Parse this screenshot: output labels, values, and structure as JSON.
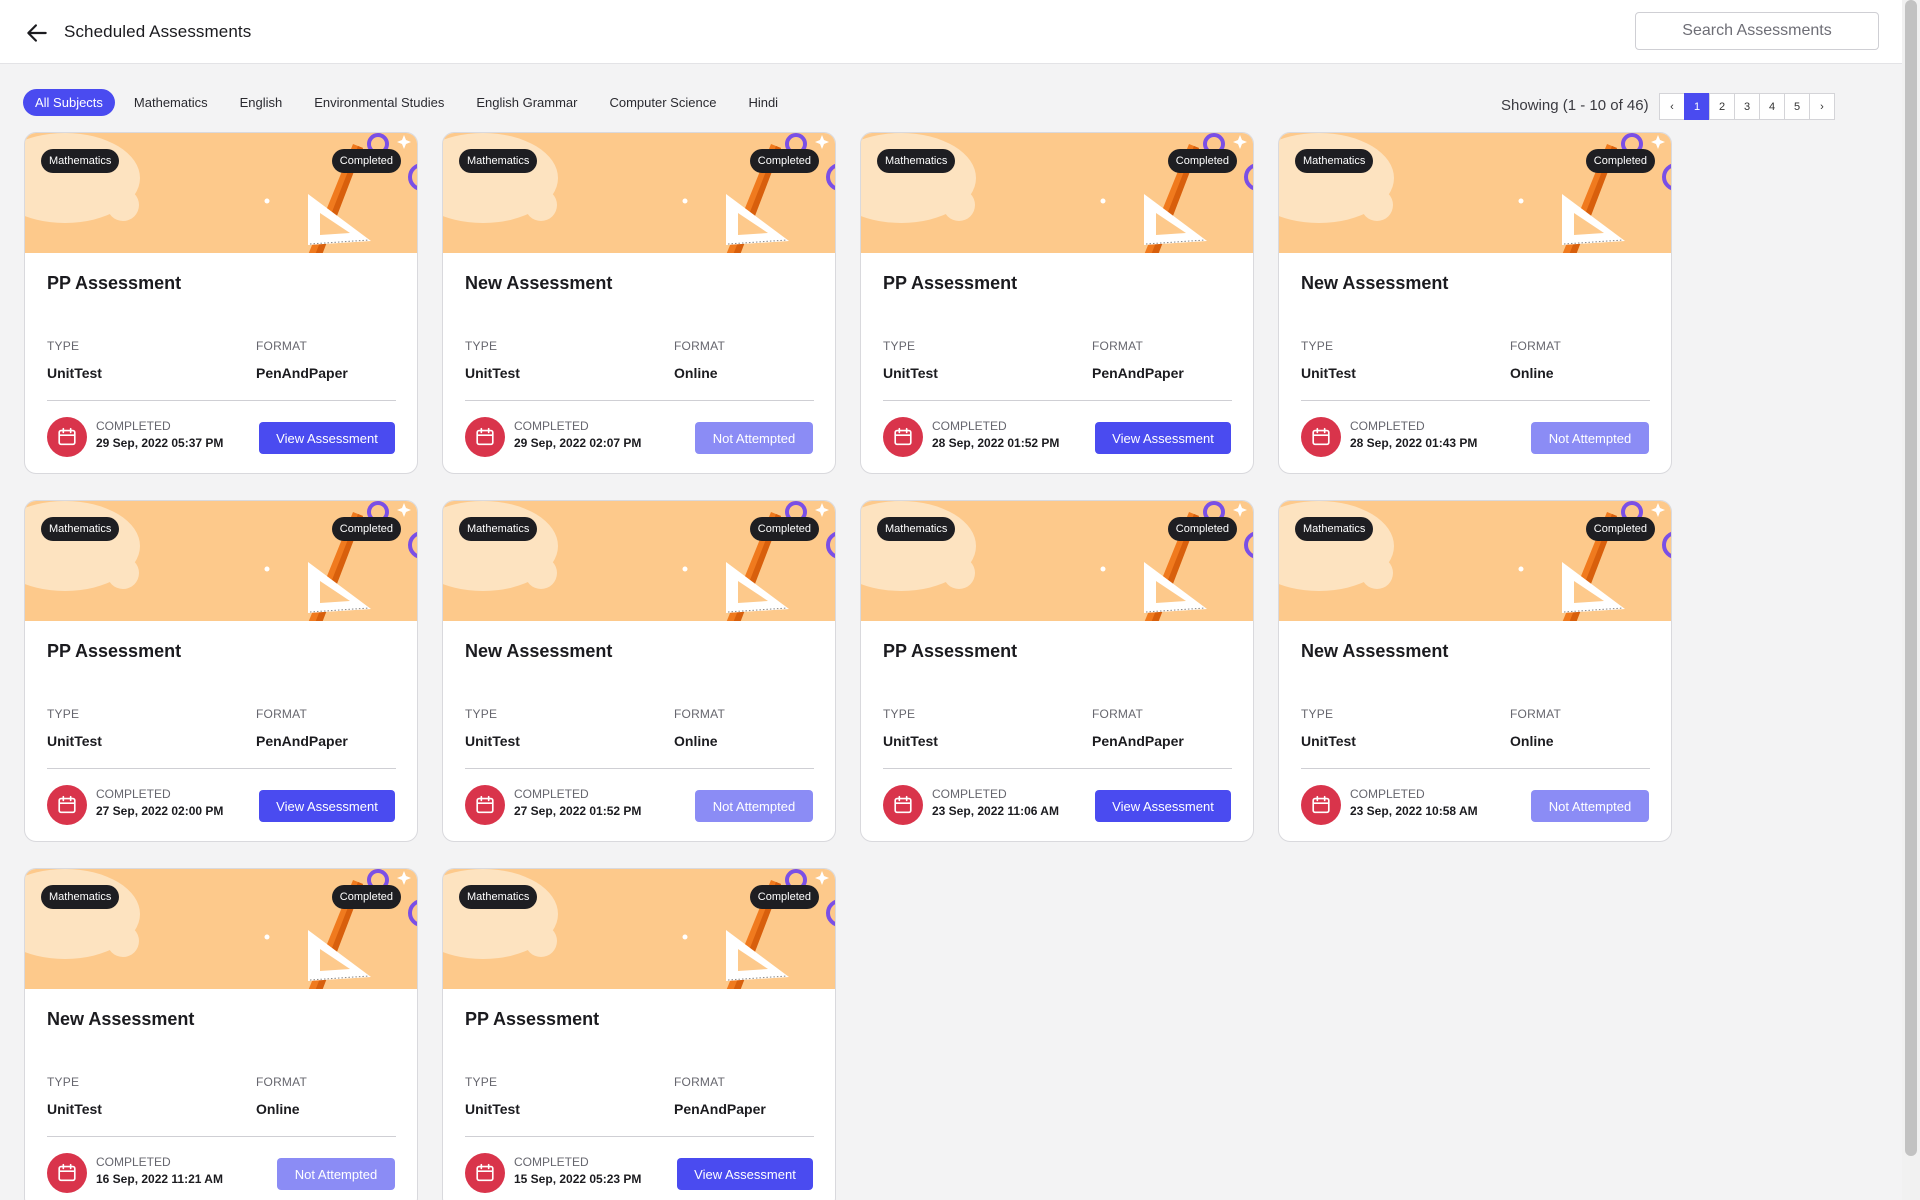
{
  "header": {
    "title": "Scheduled Assessments",
    "search_placeholder": "Search Assessments"
  },
  "filters": [
    "All Subjects",
    "Mathematics",
    "English",
    "Environmental Studies",
    "English Grammar",
    "Computer Science",
    "Hindi"
  ],
  "active_filter": "All Subjects",
  "pagination": {
    "showing": "Showing (1 - 10 of 46)",
    "prev": "‹",
    "next": "›",
    "pages": [
      "1",
      "2",
      "3",
      "4",
      "5"
    ],
    "current": "1"
  },
  "labels": {
    "type": "TYPE",
    "format": "FORMAT",
    "completed": "COMPLETED"
  },
  "colors": {
    "accent": "#4a4bf0",
    "accent_disabled": "#8b8cf5",
    "banner": "#fdc98b",
    "calendar": "#d9344b"
  },
  "cards": [
    {
      "subject": "Mathematics",
      "status": "Completed",
      "title": "PP Assessment",
      "type": "UnitTest",
      "format": "PenAndPaper",
      "date": "29 Sep, 2022 05:37 PM",
      "action": "View Assessment",
      "action_kind": "view"
    },
    {
      "subject": "Mathematics",
      "status": "Completed",
      "title": "New Assessment",
      "type": "UnitTest",
      "format": "Online",
      "date": "29 Sep, 2022 02:07 PM",
      "action": "Not Attempted",
      "action_kind": "na"
    },
    {
      "subject": "Mathematics",
      "status": "Completed",
      "title": "PP Assessment",
      "type": "UnitTest",
      "format": "PenAndPaper",
      "date": "28 Sep, 2022 01:52 PM",
      "action": "View Assessment",
      "action_kind": "view"
    },
    {
      "subject": "Mathematics",
      "status": "Completed",
      "title": "New Assessment",
      "type": "UnitTest",
      "format": "Online",
      "date": "28 Sep, 2022 01:43 PM",
      "action": "Not Attempted",
      "action_kind": "na"
    },
    {
      "subject": "Mathematics",
      "status": "Completed",
      "title": "PP Assessment",
      "type": "UnitTest",
      "format": "PenAndPaper",
      "date": "27 Sep, 2022 02:00 PM",
      "action": "View Assessment",
      "action_kind": "view"
    },
    {
      "subject": "Mathematics",
      "status": "Completed",
      "title": "New Assessment",
      "type": "UnitTest",
      "format": "Online",
      "date": "27 Sep, 2022 01:52 PM",
      "action": "Not Attempted",
      "action_kind": "na"
    },
    {
      "subject": "Mathematics",
      "status": "Completed",
      "title": "PP Assessment",
      "type": "UnitTest",
      "format": "PenAndPaper",
      "date": "23 Sep, 2022 11:06 AM",
      "action": "View Assessment",
      "action_kind": "view"
    },
    {
      "subject": "Mathematics",
      "status": "Completed",
      "title": "New Assessment",
      "type": "UnitTest",
      "format": "Online",
      "date": "23 Sep, 2022 10:58 AM",
      "action": "Not Attempted",
      "action_kind": "na"
    },
    {
      "subject": "Mathematics",
      "status": "Completed",
      "title": "New Assessment",
      "type": "UnitTest",
      "format": "Online",
      "date": "16 Sep, 2022 11:21 AM",
      "action": "Not Attempted",
      "action_kind": "na"
    },
    {
      "subject": "Mathematics",
      "status": "Completed",
      "title": "PP Assessment",
      "type": "UnitTest",
      "format": "PenAndPaper",
      "date": "15 Sep, 2022 05:23 PM",
      "action": "View Assessment",
      "action_kind": "view"
    }
  ]
}
